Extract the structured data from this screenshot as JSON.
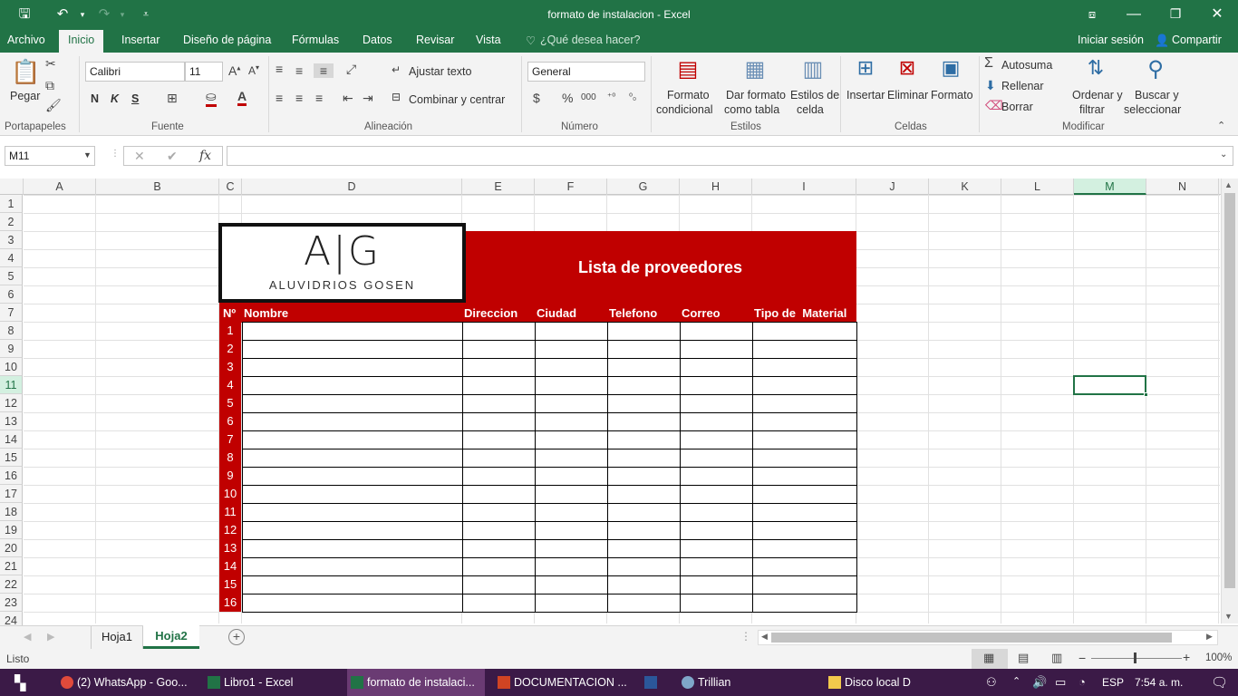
{
  "window": {
    "title": "formato de instalacion - Excel"
  },
  "ribbon_tabs": [
    "Archivo",
    "Inicio",
    "Insertar",
    "Diseño de página",
    "Fórmulas",
    "Datos",
    "Revisar",
    "Vista"
  ],
  "tell_me": "¿Qué desea hacer?",
  "account": {
    "signin": "Iniciar sesión",
    "share": "Compartir"
  },
  "clipboard": {
    "paste": "Pegar",
    "group": "Portapapeles"
  },
  "font": {
    "name": "Calibri",
    "size": "11",
    "bold": "N",
    "italic": "K",
    "underline": "S",
    "group": "Fuente"
  },
  "alignment": {
    "wrap": "Ajustar texto",
    "merge": "Combinar y centrar",
    "group": "Alineación"
  },
  "number": {
    "format": "General",
    "group": "Número"
  },
  "styles": {
    "cond1": "Formato",
    "cond2": "condicional",
    "table1": "Dar formato",
    "table2": "como tabla",
    "cell1": "Estilos de",
    "cell2": "celda",
    "group": "Estilos"
  },
  "cells": {
    "insert": "Insertar",
    "delete": "Eliminar",
    "format": "Formato",
    "group": "Celdas"
  },
  "editing": {
    "autosum": "Autosuma",
    "fill": "Rellenar",
    "clear": "Borrar",
    "sort1": "Ordenar y",
    "sort2": "filtrar",
    "find1": "Buscar y",
    "find2": "seleccionar",
    "group": "Modificar"
  },
  "name_box": "M11",
  "columns": [
    "A",
    "B",
    "C",
    "D",
    "E",
    "F",
    "G",
    "H",
    "I",
    "J",
    "K",
    "L",
    "M",
    "N"
  ],
  "rows": [
    "1",
    "2",
    "3",
    "4",
    "5",
    "6",
    "7",
    "8",
    "9",
    "10",
    "11",
    "12",
    "13",
    "14",
    "15",
    "16",
    "17",
    "18",
    "19",
    "20",
    "21",
    "22",
    "23",
    "24"
  ],
  "sheet": {
    "logo_mark": "A|G",
    "logo_text": "ALUVIDRIOS GOSEN",
    "title": "Lista de proveedores",
    "headers": [
      "Nº",
      "Nombre",
      "Direccion",
      "Ciudad",
      "Telefono",
      "Correo",
      "Tipo de  Material"
    ],
    "numbers": [
      "1",
      "2",
      "3",
      "4",
      "5",
      "6",
      "7",
      "8",
      "9",
      "10",
      "11",
      "12",
      "13",
      "14",
      "15",
      "16"
    ]
  },
  "sheet_tabs": [
    "Hoja1",
    "Hoja2"
  ],
  "status": {
    "ready": "Listo",
    "zoom": "100%"
  },
  "taskbar": {
    "items": [
      "(2) WhatsApp - Goo...",
      "Libro1 - Excel",
      "formato de instalaci...",
      "DOCUMENTACION ...",
      "",
      "Trillian",
      "Disco local D"
    ],
    "lang": "ESP",
    "time": "7:54 a. m."
  },
  "colors": {
    "excel_green": "#217346",
    "header_red": "#c00000",
    "taskbar": "#3b1a47"
  }
}
